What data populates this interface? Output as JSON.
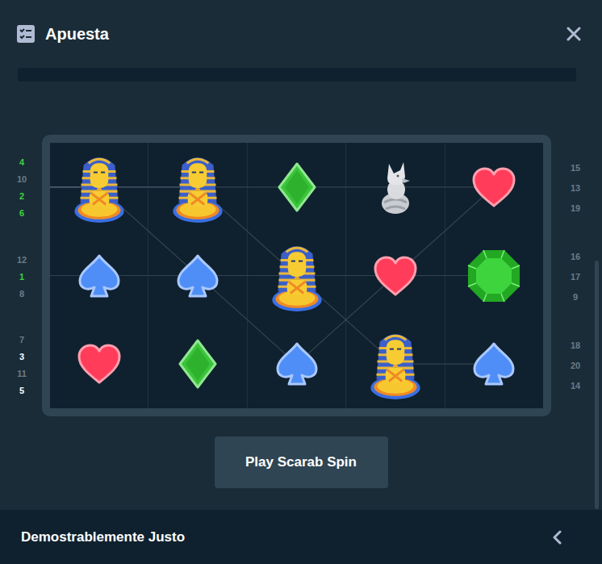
{
  "header": {
    "title": "Apuesta"
  },
  "reels": [
    {
      "symbols": [
        {
          "kind": "pharaoh"
        },
        {
          "kind": "spade"
        },
        {
          "kind": "heart"
        }
      ]
    },
    {
      "symbols": [
        {
          "kind": "pharaoh"
        },
        {
          "kind": "spade"
        },
        {
          "kind": "diamond"
        }
      ]
    },
    {
      "symbols": [
        {
          "kind": "diamond"
        },
        {
          "kind": "pharaoh"
        },
        {
          "kind": "spade"
        }
      ]
    },
    {
      "symbols": [
        {
          "kind": "wolf"
        },
        {
          "kind": "heart"
        },
        {
          "kind": "pharaoh"
        }
      ]
    },
    {
      "symbols": [
        {
          "kind": "heart"
        },
        {
          "kind": "gem"
        },
        {
          "kind": "spade"
        }
      ]
    }
  ],
  "paylines": [
    {
      "rows": [
        0,
        0,
        0,
        0,
        0
      ]
    },
    {
      "rows": [
        0,
        0,
        1,
        2,
        2
      ]
    },
    {
      "rows": [
        0,
        1,
        2,
        1,
        0
      ]
    },
    {
      "rows": [
        1,
        1,
        1,
        1,
        1
      ]
    }
  ],
  "left_labels": [
    [
      {
        "text": "4",
        "color": "#3ed23e"
      },
      {
        "text": "10",
        "color": "#6b7b87"
      },
      {
        "text": "2",
        "color": "#3ed23e"
      },
      {
        "text": "6",
        "color": "#3ed23e"
      }
    ],
    [
      {
        "text": "12",
        "color": "#6b7b87"
      },
      {
        "text": "1",
        "color": "#3ed23e"
      },
      {
        "text": "8",
        "color": "#6b7b87"
      }
    ],
    [
      {
        "text": "7",
        "color": "#6b7b87"
      },
      {
        "text": "3",
        "color": "#ffffff"
      },
      {
        "text": "11",
        "color": "#6b7b87"
      },
      {
        "text": "5",
        "color": "#ffffff"
      }
    ]
  ],
  "right_labels": [
    [
      "15",
      "13",
      "19"
    ],
    [
      "16",
      "17",
      "9"
    ],
    [
      "18",
      "20",
      "14"
    ]
  ],
  "button": {
    "label": "Play Scarab Spin"
  },
  "footer": {
    "title": "Demostrablemente Justo"
  }
}
